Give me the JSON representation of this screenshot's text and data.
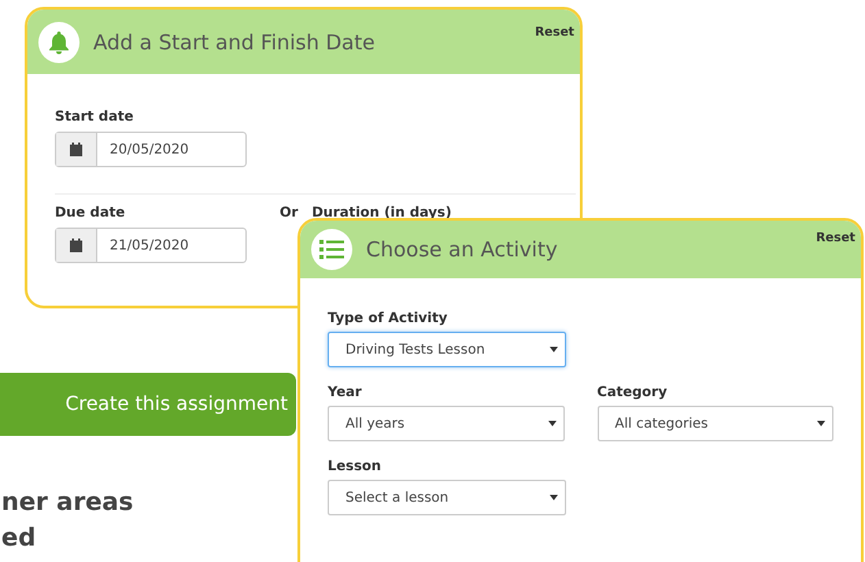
{
  "date_card": {
    "title": "Add a Start and Finish Date",
    "reset": "Reset",
    "start": {
      "label": "Start date",
      "value": "20/05/2020"
    },
    "due": {
      "label": "Due date",
      "value": "21/05/2020"
    },
    "or": "Or",
    "duration_label": "Duration (in days)"
  },
  "create_button": "Create this assignment",
  "heading_lines": [
    "ner areas",
    "ed"
  ],
  "activity_card": {
    "title": "Choose an Activity",
    "reset": "Reset",
    "rows": [
      [
        {
          "label": "Type of Activity",
          "value": "Driving Tests Lesson",
          "focused": true
        }
      ],
      [
        {
          "label": "Year",
          "value": "All years",
          "focused": false
        },
        {
          "label": "Category",
          "value": "All categories",
          "focused": false
        }
      ],
      [
        {
          "label": "Lesson",
          "value": "Select a lesson",
          "focused": false
        }
      ]
    ]
  }
}
